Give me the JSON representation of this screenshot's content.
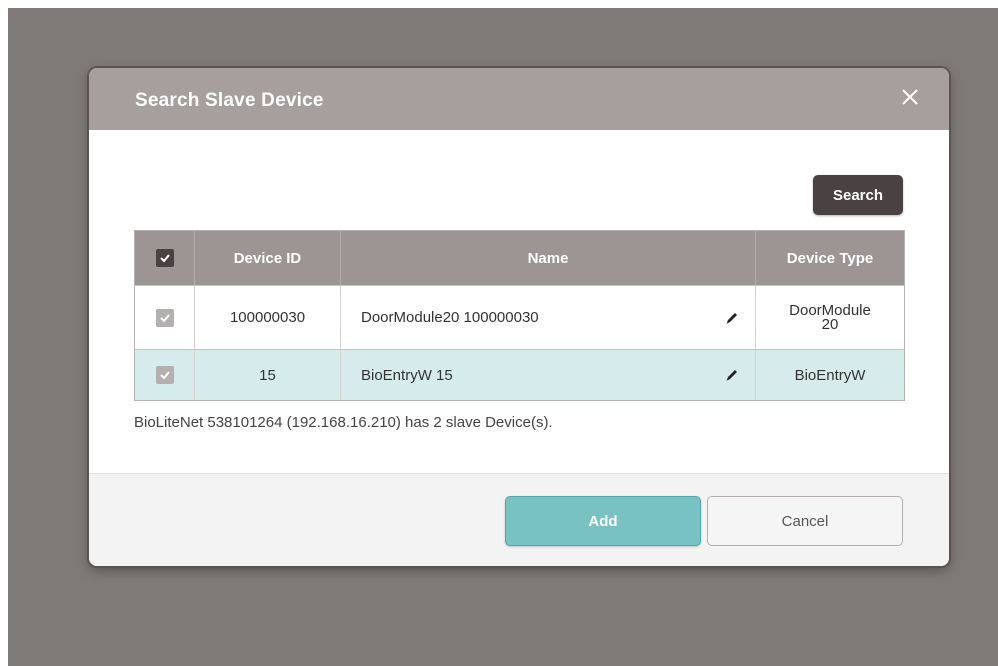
{
  "dialog": {
    "title": "Search Slave Device",
    "close_icon": "close-icon",
    "search_label": "Search"
  },
  "table": {
    "columns": [
      "Device ID",
      "Name",
      "Device Type"
    ],
    "header_checked": true,
    "rows": [
      {
        "checked": true,
        "device_id": "100000030",
        "name": "DoorModule20 100000030",
        "device_type_line1": "DoorModule",
        "device_type_line2": "20",
        "highlighted": false
      },
      {
        "checked": true,
        "device_id": "15",
        "name": "BioEntryW 15",
        "device_type_line1": "BioEntryW",
        "device_type_line2": "",
        "highlighted": true
      }
    ]
  },
  "summary": "BioLiteNet 538101264 (192.168.16.210) has 2 slave Device(s).",
  "footer": {
    "add_label": "Add",
    "cancel_label": "Cancel"
  },
  "colors": {
    "header_bg": "#a79e9e",
    "table_header_bg": "#9d9494",
    "highlight_row": "#d6ecec",
    "add_button": "#79c2c4",
    "search_button": "#4a4143"
  }
}
